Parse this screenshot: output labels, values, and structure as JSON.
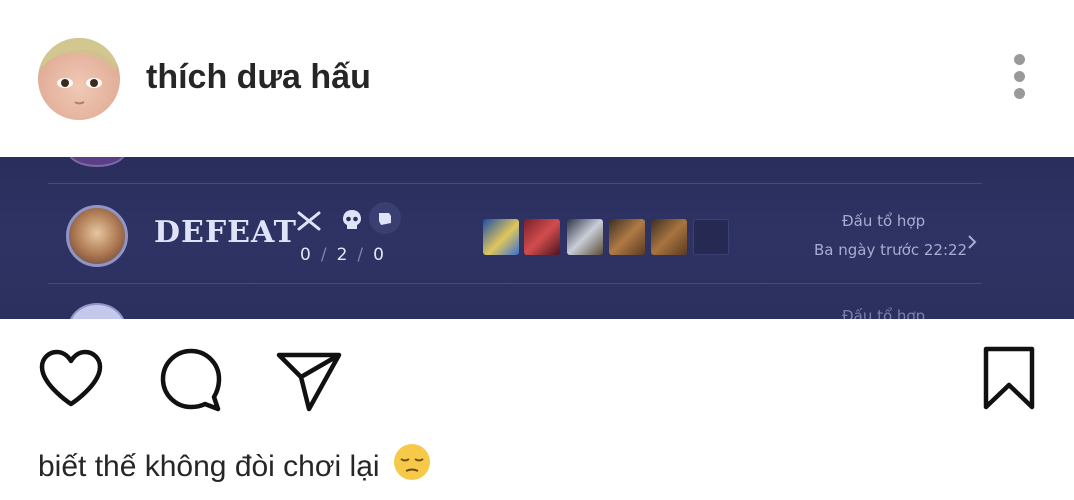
{
  "post": {
    "username": "thích dưa hấu",
    "caption": "biết thế không đòi chơi lại",
    "caption_emoji": "pensive-face"
  },
  "screenshot": {
    "result": "DEFEAT",
    "kda": {
      "kills": "0",
      "deaths": "2",
      "assists": "0"
    },
    "mode": "Đấu tổ hợp",
    "time": "Ba ngày trước 22:22",
    "faded_mode": "Đấu tổ hợp",
    "items": [
      "blade-item",
      "boots-item",
      "sword-item",
      "gauntlet-item",
      "gauntlet-item",
      "empty-slot"
    ]
  },
  "icons": {
    "more": "more-vertical-icon",
    "like": "heart-icon",
    "comment": "comment-icon",
    "share": "send-icon",
    "save": "bookmark-icon"
  },
  "colors": {
    "text": "#262626",
    "banner_bg": "#2c305e",
    "icon_grey": "#9a9a9a"
  }
}
